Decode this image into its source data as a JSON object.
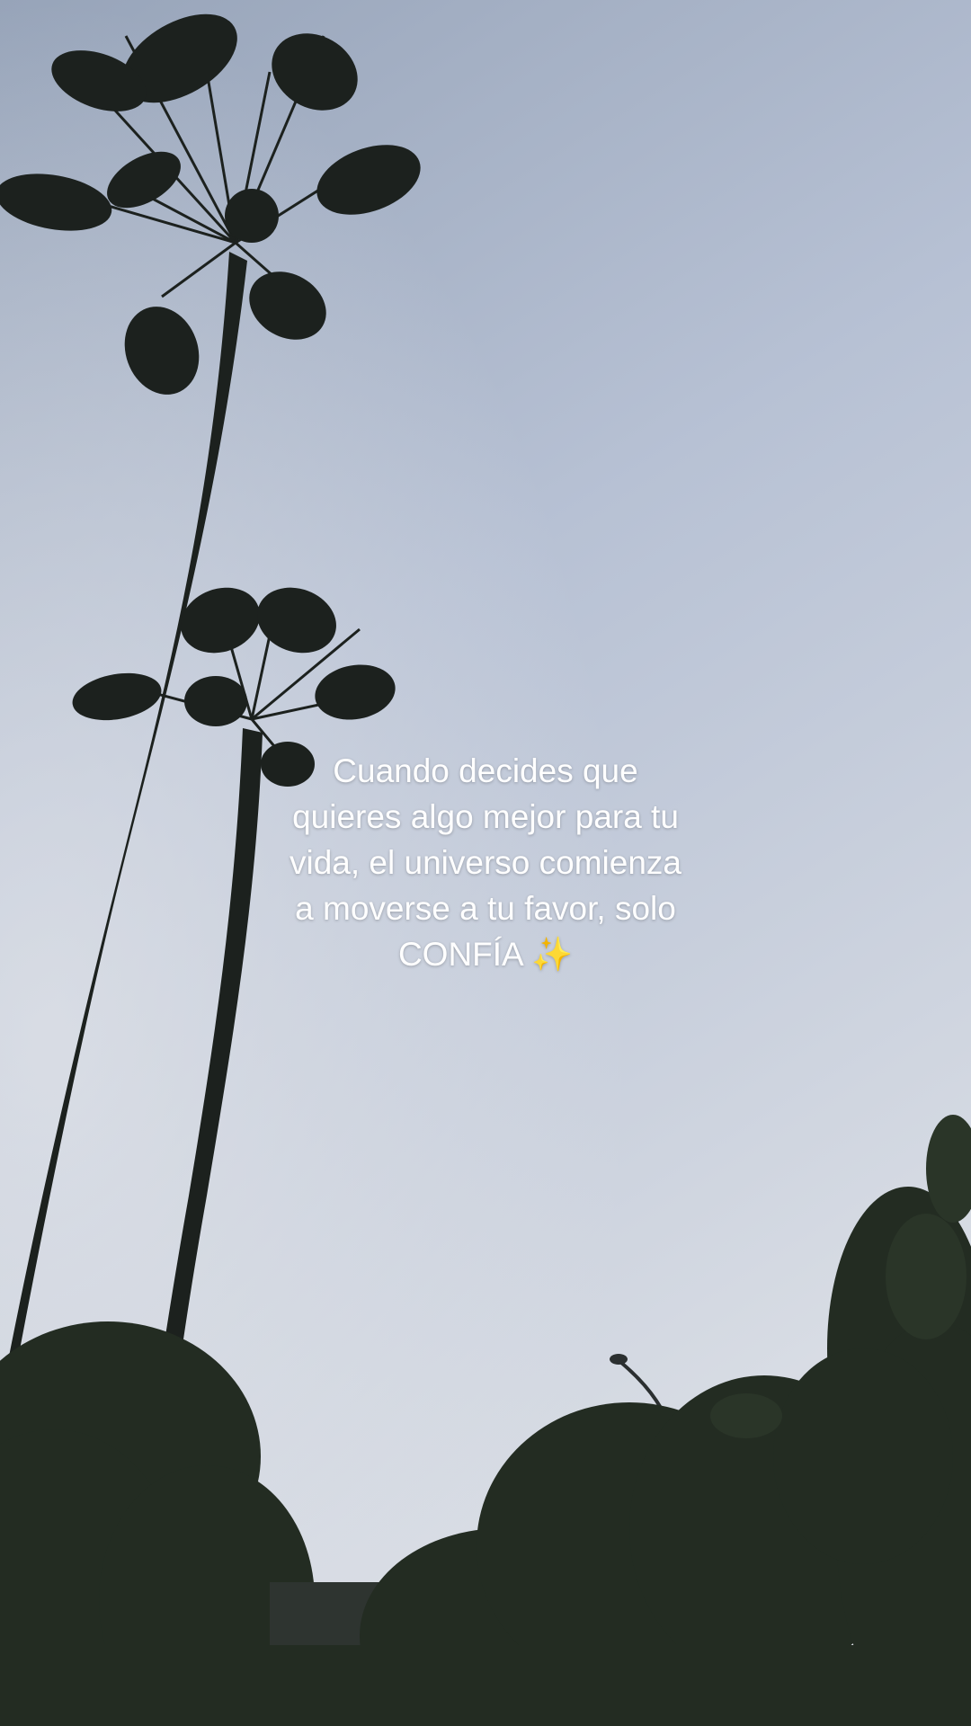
{
  "caption": {
    "lines": [
      "Cuando decides que",
      "quieres algo mejor para tu",
      "vida, el universo comienza",
      "a moverse a tu favor, solo",
      "CONFÍA"
    ],
    "emoji": "✨",
    "emoji_name": "sparkles-emoji"
  },
  "colors": {
    "sky_top": "#9aa6ba",
    "sky_mid": "#b9c3d6",
    "sky_bottom": "#d6dbe3",
    "silhouette": "#1b1f1c",
    "foliage": "#253024",
    "caption_text": "#ffffff"
  }
}
